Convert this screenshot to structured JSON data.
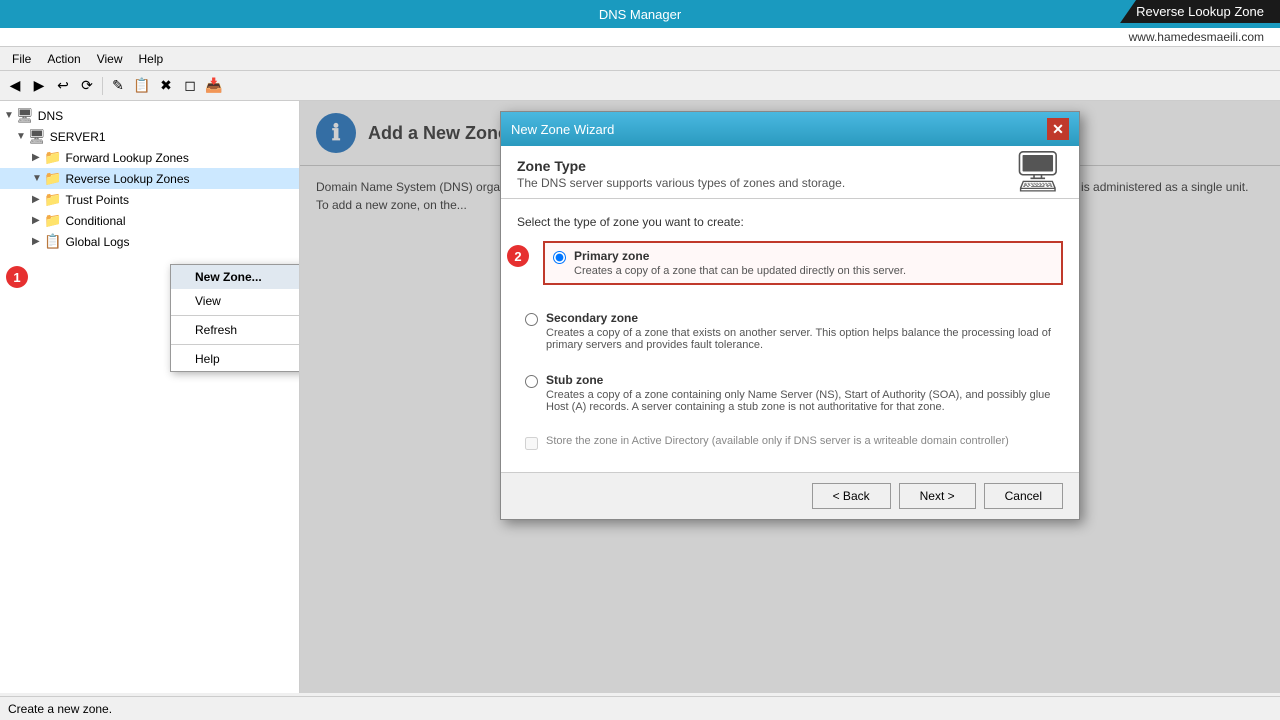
{
  "titlebar": {
    "title": "DNS Manager",
    "banner": "Reverse Lookup Zone",
    "website": "www.hamedesmaeili.com"
  },
  "menu": {
    "items": [
      "File",
      "Action",
      "View",
      "Help"
    ]
  },
  "toolbar": {
    "buttons": [
      "◀",
      "▶",
      "↩",
      "⟳",
      "✎",
      "📋",
      "✖",
      "◻",
      "📥"
    ]
  },
  "tree": {
    "root": "DNS",
    "server": "SERVER1",
    "nodes": [
      {
        "label": "Forward Lookup Zones",
        "indent": 1,
        "expanded": false
      },
      {
        "label": "Reverse Lookup Zones",
        "indent": 1,
        "expanded": true,
        "selected": true
      },
      {
        "label": "Trust Points",
        "indent": 1,
        "expanded": false
      },
      {
        "label": "Conditional",
        "indent": 1,
        "expanded": false
      },
      {
        "label": "Global Logs",
        "indent": 1,
        "expanded": false
      }
    ]
  },
  "context_menu": {
    "items": [
      {
        "label": "New Zone...",
        "highlighted": true
      },
      {
        "label": "View",
        "hasArrow": true
      },
      {
        "label": "Refresh"
      },
      {
        "label": "Help"
      }
    ]
  },
  "content": {
    "header": "Add a New Zone",
    "text": "Domain Name System (DNS) organizes and identifies Domain Name Syste...\nzone or more contig...\n...d a new zone, on the..."
  },
  "wizard": {
    "title": "New Zone Wizard",
    "section": {
      "title": "Zone Type",
      "subtitle": "The DNS server supports various types of zones and storage."
    },
    "question": "Select the type of zone you want to create:",
    "options": [
      {
        "id": "primary",
        "label": "Primary zone",
        "description": "Creates a copy of a zone that can be updated directly on this server.",
        "selected": true
      },
      {
        "id": "secondary",
        "label": "Secondary zone",
        "description": "Creates a copy of a zone that exists on another server. This option helps balance the processing load of primary servers and provides fault tolerance.",
        "selected": false
      },
      {
        "id": "stub",
        "label": "Stub zone",
        "description": "Creates a copy of a zone containing only Name Server (NS), Start of Authority (SOA), and possibly glue Host (A) records. A server containing a stub zone is not authoritative for that zone.",
        "selected": false
      }
    ],
    "checkbox": {
      "label": "Store the zone in Active Directory (available only if DNS server is a writeable domain controller)",
      "checked": false,
      "disabled": true
    },
    "buttons": {
      "back": "< Back",
      "next": "Next >",
      "cancel": "Cancel"
    }
  },
  "annotations": {
    "circle1": "1",
    "circle2": "2"
  },
  "statusbar": {
    "text": "Create a new zone."
  }
}
